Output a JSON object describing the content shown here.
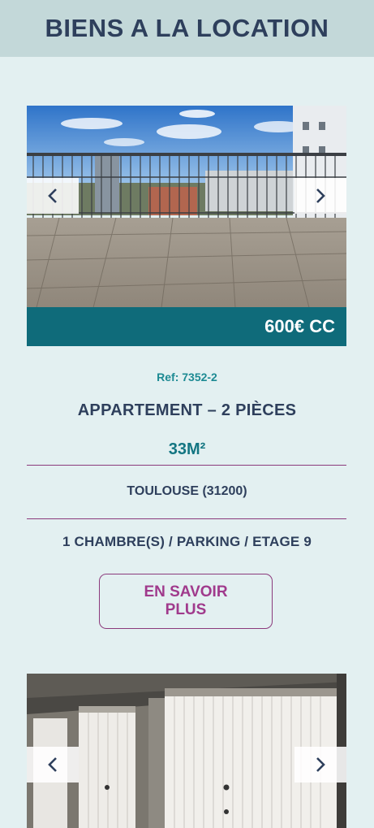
{
  "header": {
    "title": "BIENS A LA LOCATION"
  },
  "listings": [
    {
      "price": "600€ CC",
      "ref": "Ref: 7352-2",
      "type": "APPARTEMENT – 2 PIÈCES",
      "surface": "33M²",
      "city": "TOULOUSE (31200)",
      "features": "1 CHAMBRE(S) / PARKING / ETAGE 9",
      "cta": "EN SAVOIR PLUS"
    },
    {
      "photo": "garage doors"
    }
  ],
  "icons": {
    "prev": "chevron-left-icon",
    "next": "chevron-right-icon"
  },
  "colors": {
    "header_bg": "#c3d8d9",
    "page_bg": "#e3f0f1",
    "title": "#2e3f5c",
    "price_bar": "#0f6b7a",
    "accent_teal": "#137582",
    "accent_purple": "#8b3a7c"
  }
}
